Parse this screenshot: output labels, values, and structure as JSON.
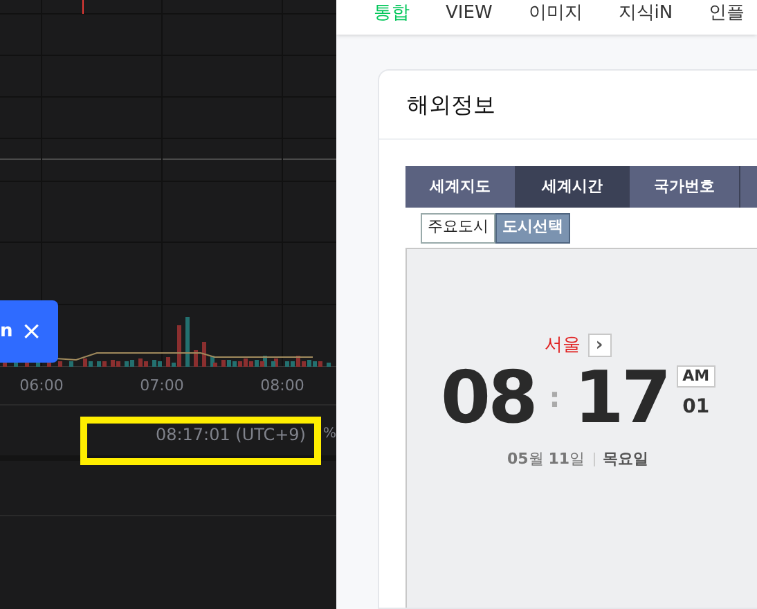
{
  "chart": {
    "toast": {
      "text": "n",
      "close": "×"
    },
    "x_ticks": [
      "06:00",
      "07:00",
      "08:00"
    ]
  },
  "status_bar": {
    "time": "08:17:01 (UTC+9)",
    "highlighted": true,
    "unit": "%"
  },
  "nav": [
    {
      "label": "통합",
      "selected": true
    },
    {
      "label": "VIEW",
      "selected": false
    },
    {
      "label": "이미지",
      "selected": false
    },
    {
      "label": "지식iN",
      "selected": false
    },
    {
      "label": "인플",
      "selected": false
    }
  ],
  "card": {
    "title": "해외정보",
    "tabs": [
      {
        "label": "세계지도",
        "selected": false
      },
      {
        "label": "세계시간",
        "selected": true
      },
      {
        "label": "국가번호",
        "selected": false
      }
    ],
    "sub_tabs": [
      {
        "label": "주요도시",
        "selected": false
      },
      {
        "label": "도시선택",
        "selected": true
      }
    ],
    "clock": {
      "city": "서울",
      "next": "›",
      "hour": "08",
      "separator": ":",
      "minute": "17",
      "meridiem": "AM",
      "second": "01",
      "date": "**05**월 **11**일",
      "weekday": "목요일"
    }
  }
}
